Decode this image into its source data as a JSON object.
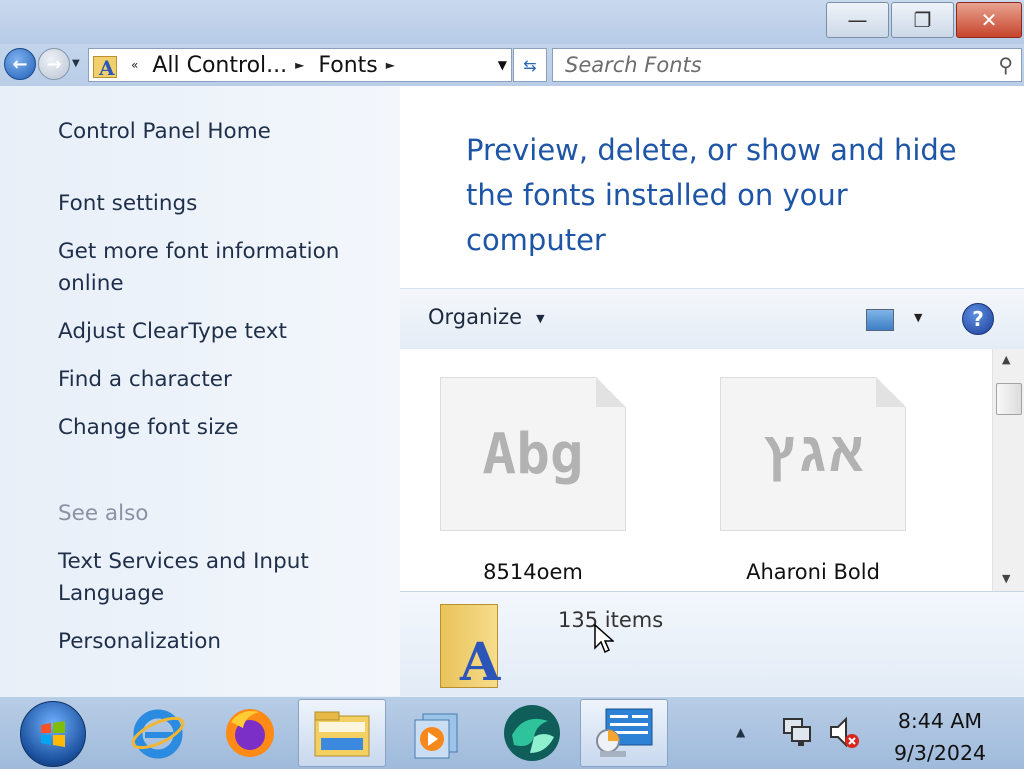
{
  "window": {
    "controls": {
      "minimize": "—",
      "restore": "❐",
      "close": "✕"
    }
  },
  "address_bar": {
    "overflow": "«",
    "crumbs": [
      "All Control...",
      "Fonts"
    ],
    "separator": "►"
  },
  "search": {
    "placeholder": "Search Fonts"
  },
  "left_pane": {
    "items": [
      "Control Panel Home",
      "Font settings",
      "Get more font information online",
      "Adjust ClearType text",
      "Find a character",
      "Change font size"
    ],
    "see_also_heading": "See also",
    "see_also_items": [
      "Text Services and Input Language",
      "Personalization"
    ]
  },
  "content": {
    "heading": "Preview, delete, or show and hide the fonts installed on your computer",
    "toolbar": {
      "organize": "Organize",
      "help": "?"
    },
    "fonts": [
      {
        "name": "8514oem",
        "preview": "Abg"
      },
      {
        "name": "Aharoni Bold",
        "preview": "אגץ"
      }
    ],
    "details": {
      "count": "135 items"
    }
  },
  "taskbar": {
    "apps": [
      "internet-explorer",
      "firefox",
      "windows-explorer",
      "media-player",
      "app-5",
      "control-panel"
    ],
    "time": "8:44 AM",
    "date": "9/3/2024"
  },
  "colors": {
    "heading": "#1e55a6",
    "link": "#1f2f4a",
    "muted": "#8a93a3"
  }
}
